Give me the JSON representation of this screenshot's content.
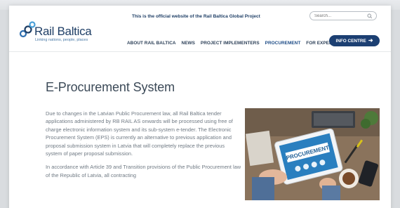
{
  "header": {
    "official_note": "This is the official website of the Rail Baltica Global Project",
    "logo": {
      "name": "Rail Baltica",
      "tagline": "Linking nations, people, places"
    },
    "search": {
      "placeholder": "Search..."
    },
    "nav": [
      {
        "label": "ABOUT RAIL BALTICA",
        "active": false
      },
      {
        "label": "NEWS",
        "active": false
      },
      {
        "label": "PROJECT IMPLEMENTERS",
        "active": false
      },
      {
        "label": "PROCUREMENT",
        "active": true
      },
      {
        "label": "FOR EXPERTS",
        "active": false
      }
    ],
    "info_centre_label": "INFO CENTRE"
  },
  "main": {
    "title": "E-Procurement System",
    "paragraphs": [
      "Due to changes in the Latvian Public Procurement law, all Rail Baltica tender applications administered by RB RAIL AS onwards will be processed using free of charge electronic information system and its sub-system e-tender. The Electronic Procurement System (EPS) is currently an alternative to previous application and proposal submission system in Latvia that will completely replace the previous system of paper proposal submission.",
      "In accordance with Article 39 and Transition provisions of the Public Procurement law of the Republic of Latvia, all contracting"
    ],
    "illustration": {
      "screen_text": "PROCUREMENT"
    }
  },
  "colors": {
    "brand_navy": "#1c3f72",
    "nav_text": "#2b3f57",
    "body_text": "#707a84"
  }
}
